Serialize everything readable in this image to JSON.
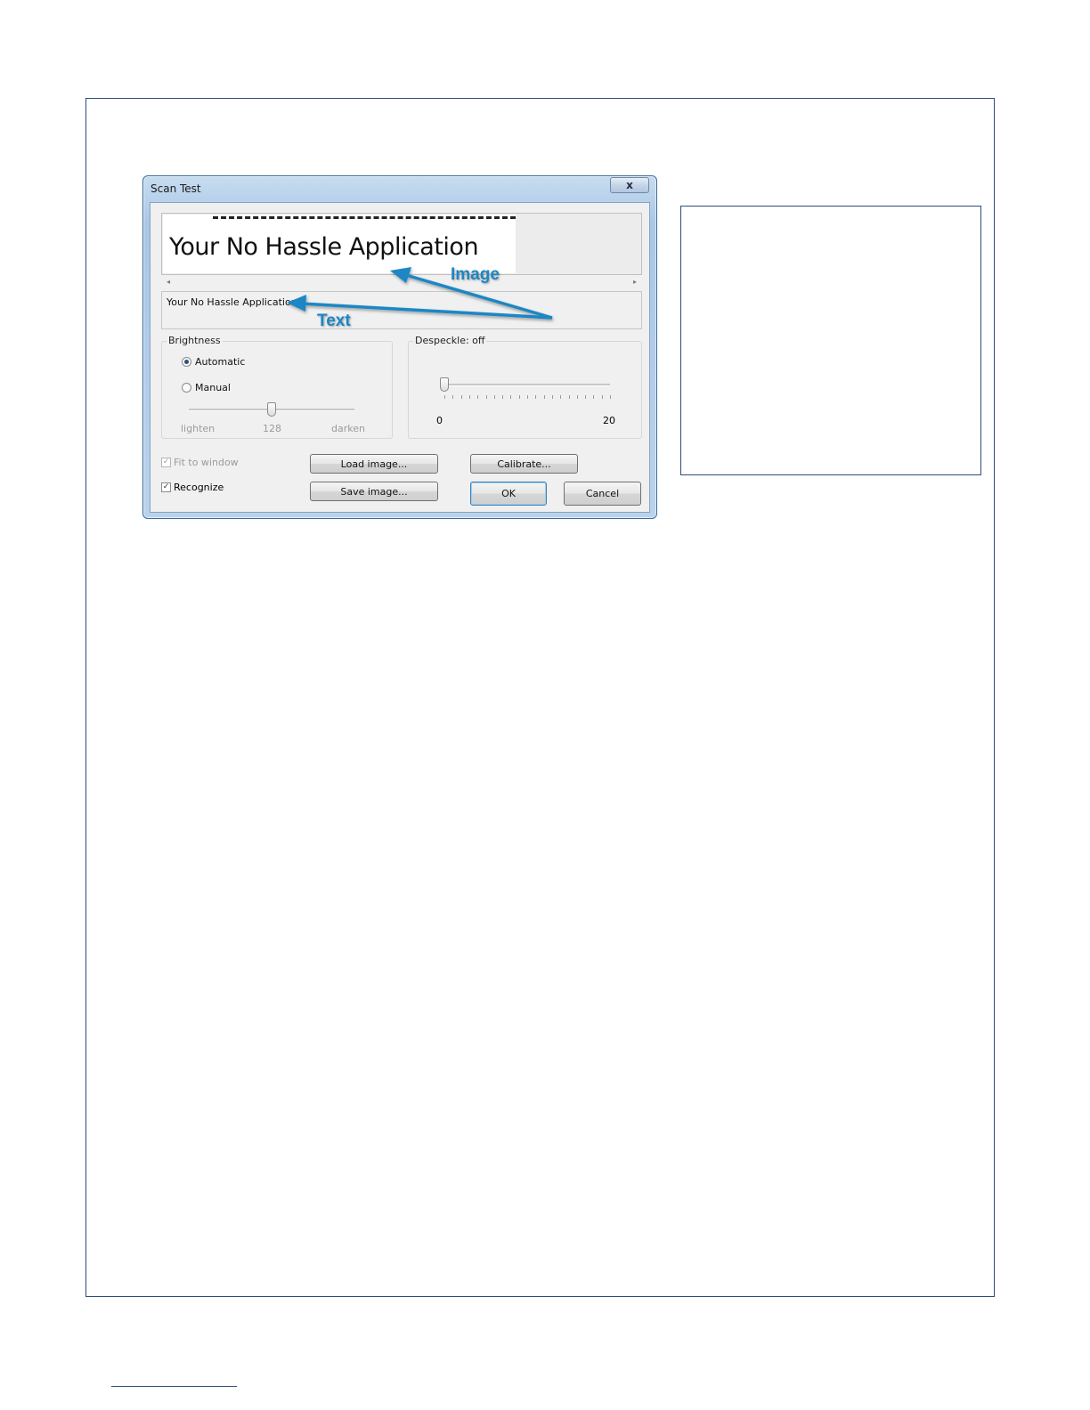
{
  "window": {
    "title": "Scan Test",
    "close_glyph": "x",
    "preview_text": "Your No Hassle Application",
    "scroll_left": "◂",
    "scroll_right": "▸",
    "recognized_text": "Your No Hassle Application"
  },
  "annotations": {
    "image_label": "Image",
    "text_label": "Text",
    "color": "#1d87c4"
  },
  "brightness": {
    "label": "Brightness",
    "automatic_label": "Automatic",
    "manual_label": "Manual",
    "selected": "Automatic",
    "min_label": "lighten",
    "value_label": "128",
    "max_label": "darken",
    "value": 128,
    "range": [
      0,
      255
    ]
  },
  "despeckle": {
    "label": "Despeckle: off",
    "min_label": "0",
    "max_label": "20",
    "value": 0,
    "range": [
      0,
      20
    ]
  },
  "options": {
    "fit_to_window": {
      "label": "Fit to window",
      "checked": true,
      "enabled": false,
      "glyph": "✓"
    },
    "recognize": {
      "label": "Recognize",
      "checked": true,
      "enabled": true,
      "glyph": "✓"
    }
  },
  "buttons": {
    "load": "Load image...",
    "save": "Save image...",
    "calibrate": "Calibrate...",
    "ok": "OK",
    "cancel": "Cancel"
  }
}
